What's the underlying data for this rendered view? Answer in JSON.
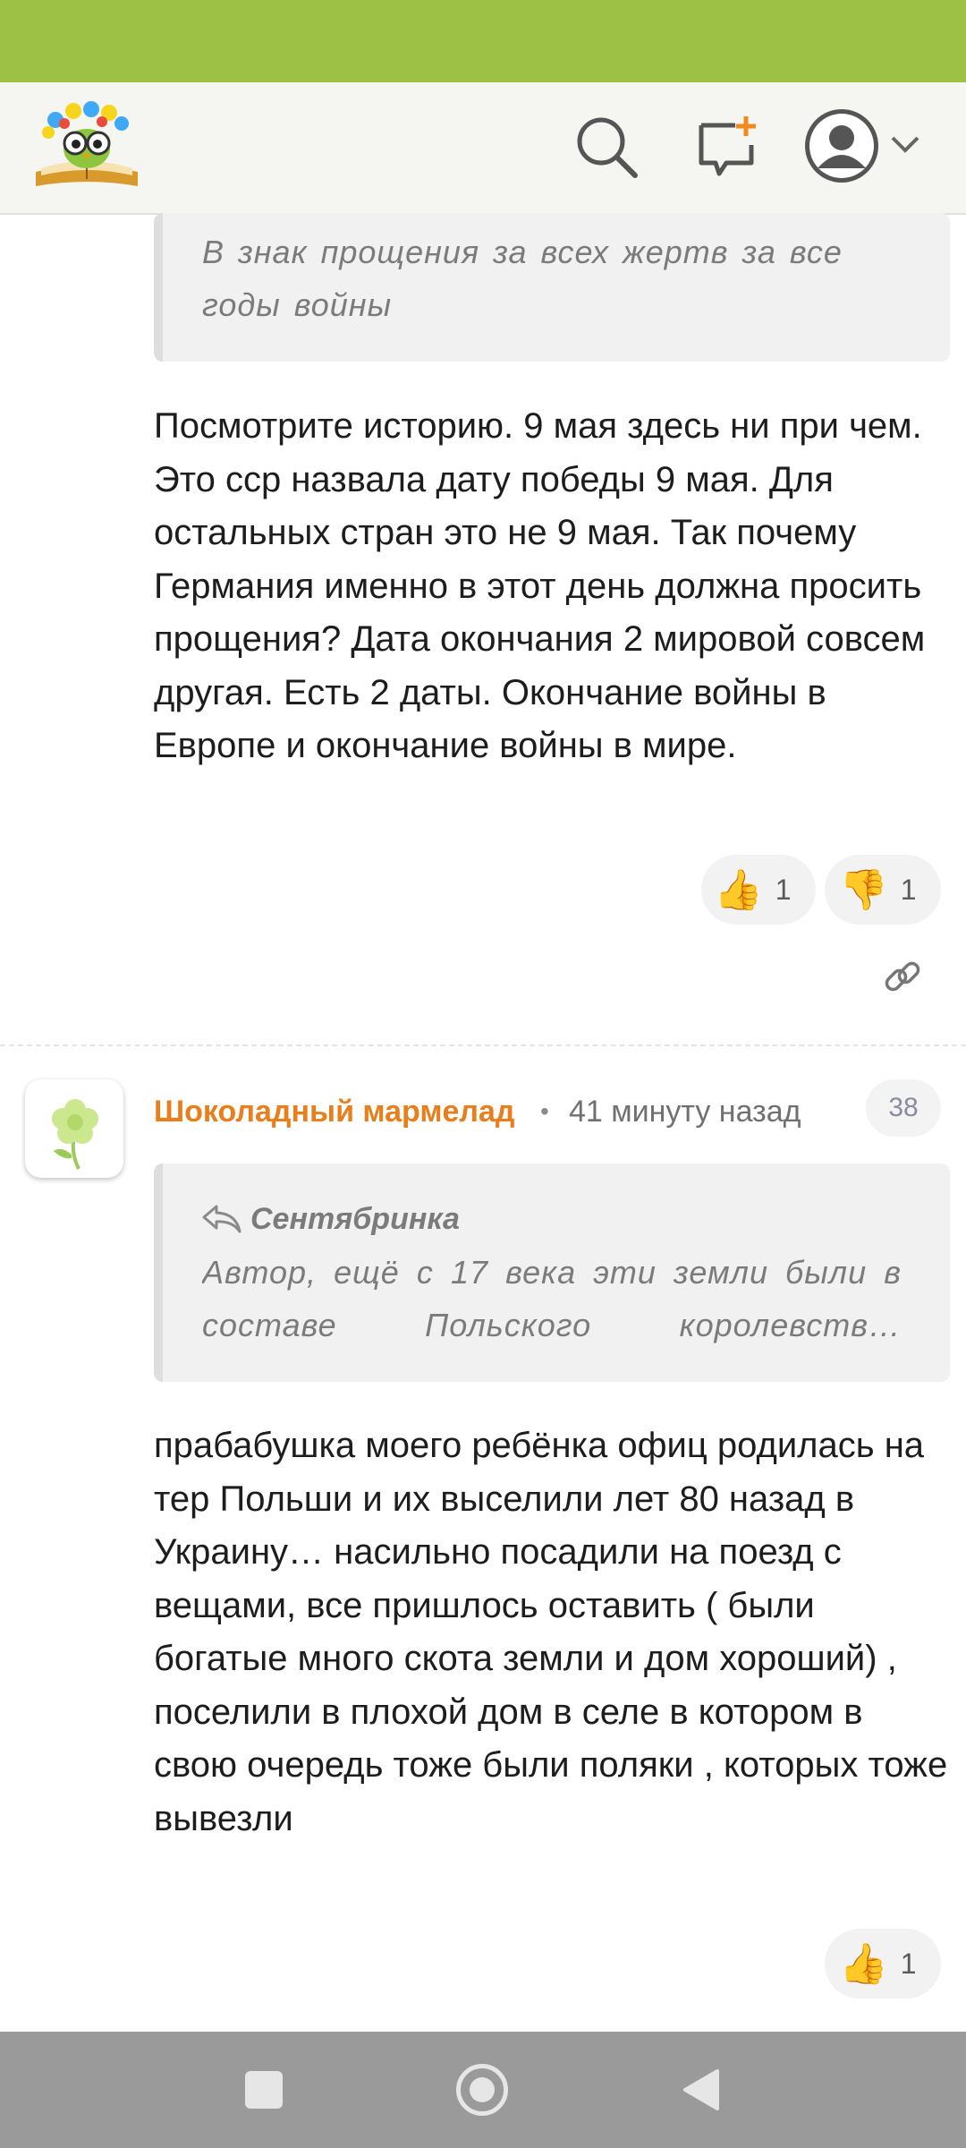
{
  "header": {
    "logo_icon": "book-owl-logo-icon",
    "search_icon": "search-icon",
    "new_post_icon": "new-message-icon",
    "avatar_icon": "avatar-icon",
    "menu_chevron": "chevron-down-icon"
  },
  "comment1": {
    "quote_text": "В знак прощения за всех жертв за все годы войны",
    "body": "Посмотрите историю. 9 мая здесь ни при чем. Это сср назвала дату победы 9 мая. Для остальных стран это не 9 мая. Так почему Германия именно в этот день должна просить прощения? Дата окончания 2 мировой совсем другая. Есть 2 даты. Окончание войны в Европе и окончание войны в мире.",
    "likes": "1",
    "dislikes": "1",
    "link_icon": "link-icon"
  },
  "comment2": {
    "author": "Шоколадный мармелад",
    "separator": "•",
    "time": "41 минуту назад",
    "number": "38",
    "avatar_icon": "flower-avatar-icon",
    "quote_author": "Сентябринка",
    "quote_text": "Автор, ещё с 17 века эти земли были в составе Польского королевств…",
    "body": "прабабушка моего ребёнка офиц родилась на тер Польши и их выселили лет 80 назад в Украину… насильно посадили на поезд с вещами, все пришлось оставить ( были богатые много скота земли и дом хороший) , поселили в плохой дом в селе в котором в свою очередь тоже были поляки , которых тоже вывезли",
    "likes": "1"
  },
  "navbar": {
    "recent_icon": "square-icon",
    "home_icon": "circle-icon",
    "back_icon": "triangle-back-icon"
  },
  "colors": {
    "status_bar": "#9dc144",
    "author": "#e87f1c",
    "navbar": "#9a9a9a"
  }
}
